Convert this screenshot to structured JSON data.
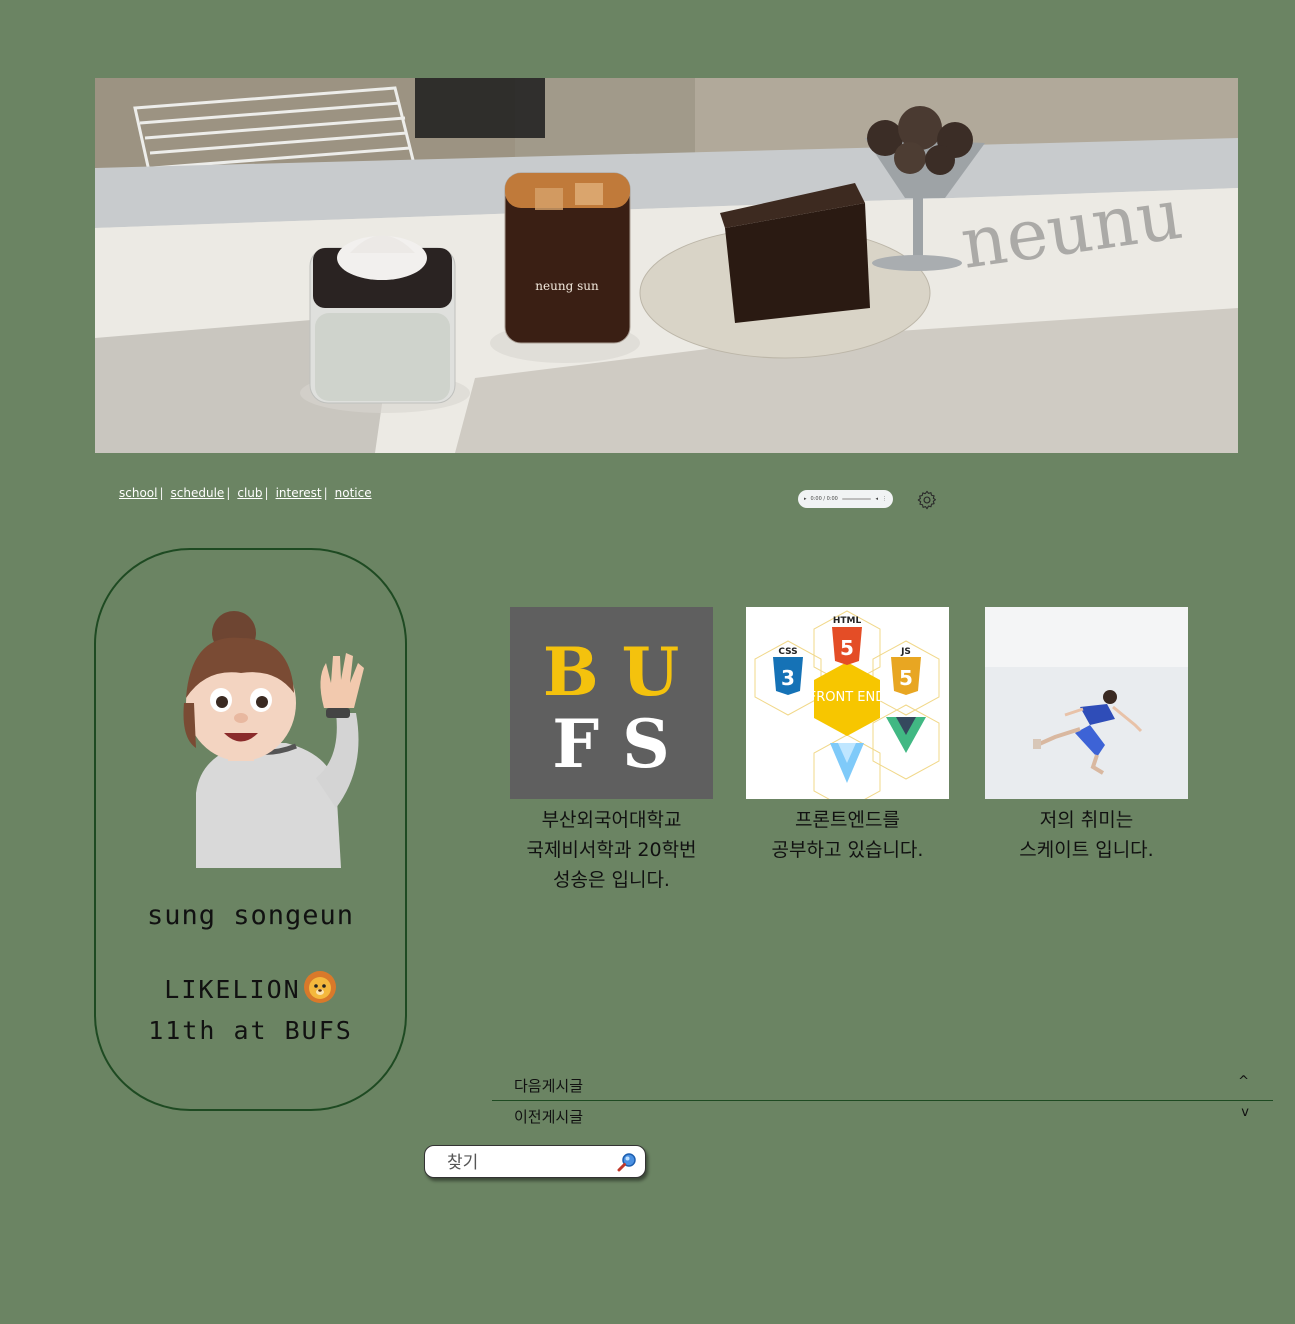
{
  "banner": {
    "alt": "cafe window with drinks and desserts",
    "cup_text": "neung sun",
    "window_text": "neunu"
  },
  "nav": {
    "items": [
      "school",
      "schedule",
      "club",
      "interest",
      "notice"
    ],
    "separator": "|"
  },
  "audio": {
    "time": "0:00 / 0:00"
  },
  "profile": {
    "name": "sung songeun",
    "line1": "LIKELION",
    "line2": "11th at BUFS",
    "emoji": "lion-icon"
  },
  "cards": [
    {
      "logo_top": "B U",
      "logo_bottom": "F S",
      "caption": "부산외국어대학교\n국제비서학과 20학번\n성송은 입니다."
    },
    {
      "center_label": "FRONT END",
      "caption": "프론트엔드를\n공부하고 있습니다."
    },
    {
      "caption": "저의 취미는\n스케이트 입니다."
    }
  ],
  "post_nav": {
    "next": {
      "label": "다음게시글",
      "arrow": "^"
    },
    "prev": {
      "label": "이전게시글",
      "arrow": "v"
    }
  },
  "search": {
    "placeholder": "찾기"
  },
  "colors": {
    "background": "#6b8463",
    "accent": "#1e4a22",
    "bufs_yellow": "#f4c20d"
  }
}
